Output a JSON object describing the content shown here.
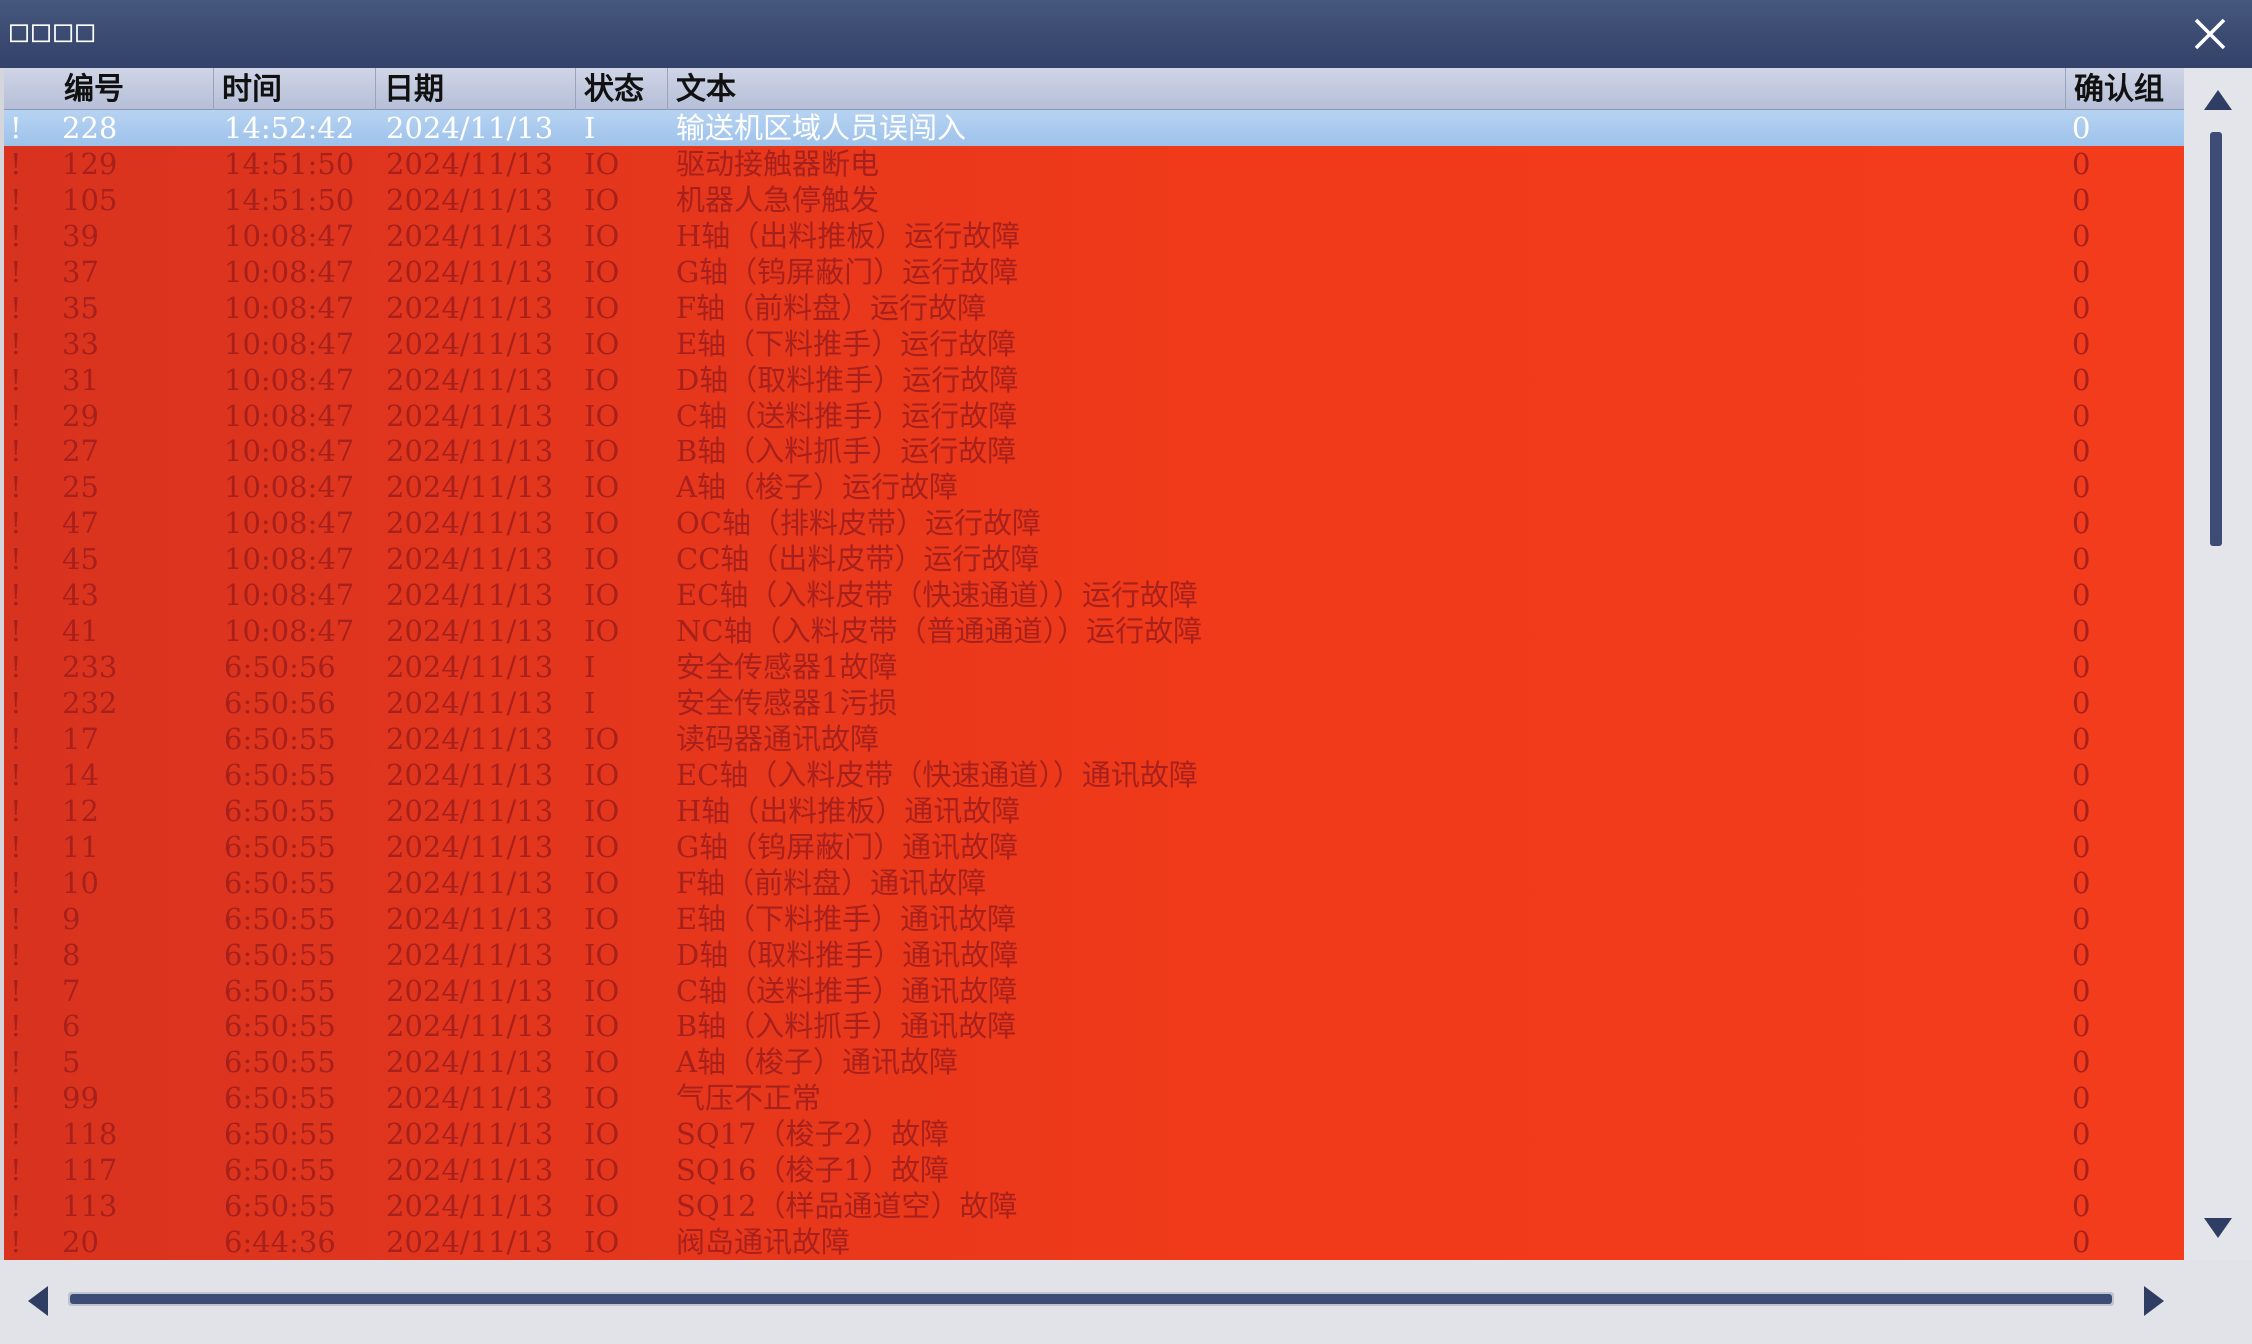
{
  "window": {
    "title": "□□□□",
    "close_icon": "close-icon"
  },
  "columns": {
    "num": "编号",
    "time": "时间",
    "date": "日期",
    "state": "状态",
    "text": "文本",
    "group": "确认组"
  },
  "colors": {
    "row_alarm_bg": "#f03a1a",
    "row_alarm_text": "#a8201c",
    "row_selected_bg": "#a8c8ee",
    "titlebar": "#3a4a70"
  },
  "rows": [
    {
      "mark": "!",
      "num": "228",
      "time": "14:52:42",
      "date": "2024/11/13",
      "state": "I",
      "text": "输送机区域人员误闯入",
      "group": "0",
      "selected": true
    },
    {
      "mark": "!",
      "num": "129",
      "time": "14:51:50",
      "date": "2024/11/13",
      "state": "IO",
      "text": "驱动接触器断电",
      "group": "0"
    },
    {
      "mark": "!",
      "num": "105",
      "time": "14:51:50",
      "date": "2024/11/13",
      "state": "IO",
      "text": "机器人急停触发",
      "group": "0"
    },
    {
      "mark": "!",
      "num": "39",
      "time": "10:08:47",
      "date": "2024/11/13",
      "state": "IO",
      "text": "H轴（出料推板）运行故障",
      "group": "0"
    },
    {
      "mark": "!",
      "num": "37",
      "time": "10:08:47",
      "date": "2024/11/13",
      "state": "IO",
      "text": "G轴（钨屏蔽门）运行故障",
      "group": "0"
    },
    {
      "mark": "!",
      "num": "35",
      "time": "10:08:47",
      "date": "2024/11/13",
      "state": "IO",
      "text": "F轴（前料盘）运行故障",
      "group": "0"
    },
    {
      "mark": "!",
      "num": "33",
      "time": "10:08:47",
      "date": "2024/11/13",
      "state": "IO",
      "text": "E轴（下料推手）运行故障",
      "group": "0"
    },
    {
      "mark": "!",
      "num": "31",
      "time": "10:08:47",
      "date": "2024/11/13",
      "state": "IO",
      "text": "D轴（取料推手）运行故障",
      "group": "0"
    },
    {
      "mark": "!",
      "num": "29",
      "time": "10:08:47",
      "date": "2024/11/13",
      "state": "IO",
      "text": "C轴（送料推手）运行故障",
      "group": "0"
    },
    {
      "mark": "!",
      "num": "27",
      "time": "10:08:47",
      "date": "2024/11/13",
      "state": "IO",
      "text": "B轴（入料抓手）运行故障",
      "group": "0"
    },
    {
      "mark": "!",
      "num": "25",
      "time": "10:08:47",
      "date": "2024/11/13",
      "state": "IO",
      "text": "A轴（梭子）运行故障",
      "group": "0"
    },
    {
      "mark": "!",
      "num": "47",
      "time": "10:08:47",
      "date": "2024/11/13",
      "state": "IO",
      "text": "OC轴（排料皮带）运行故障",
      "group": "0"
    },
    {
      "mark": "!",
      "num": "45",
      "time": "10:08:47",
      "date": "2024/11/13",
      "state": "IO",
      "text": "CC轴（出料皮带）运行故障",
      "group": "0"
    },
    {
      "mark": "!",
      "num": "43",
      "time": "10:08:47",
      "date": "2024/11/13",
      "state": "IO",
      "text": "EC轴（入料皮带（快速通道））运行故障",
      "group": "0"
    },
    {
      "mark": "!",
      "num": "41",
      "time": "10:08:47",
      "date": "2024/11/13",
      "state": "IO",
      "text": "NC轴（入料皮带（普通通道））运行故障",
      "group": "0"
    },
    {
      "mark": "!",
      "num": "233",
      "time": "6:50:56",
      "date": "2024/11/13",
      "state": "I",
      "text": "安全传感器1故障",
      "group": "0"
    },
    {
      "mark": "!",
      "num": "232",
      "time": "6:50:56",
      "date": "2024/11/13",
      "state": "I",
      "text": "安全传感器1污损",
      "group": "0"
    },
    {
      "mark": "!",
      "num": "17",
      "time": "6:50:55",
      "date": "2024/11/13",
      "state": "IO",
      "text": "读码器通讯故障",
      "group": "0"
    },
    {
      "mark": "!",
      "num": "14",
      "time": "6:50:55",
      "date": "2024/11/13",
      "state": "IO",
      "text": "EC轴（入料皮带（快速通道））通讯故障",
      "group": "0"
    },
    {
      "mark": "!",
      "num": "12",
      "time": "6:50:55",
      "date": "2024/11/13",
      "state": "IO",
      "text": "H轴（出料推板）通讯故障",
      "group": "0"
    },
    {
      "mark": "!",
      "num": "11",
      "time": "6:50:55",
      "date": "2024/11/13",
      "state": "IO",
      "text": "G轴（钨屏蔽门）通讯故障",
      "group": "0"
    },
    {
      "mark": "!",
      "num": "10",
      "time": "6:50:55",
      "date": "2024/11/13",
      "state": "IO",
      "text": "F轴（前料盘）通讯故障",
      "group": "0"
    },
    {
      "mark": "!",
      "num": "9",
      "time": "6:50:55",
      "date": "2024/11/13",
      "state": "IO",
      "text": "E轴（下料推手）通讯故障",
      "group": "0"
    },
    {
      "mark": "!",
      "num": "8",
      "time": "6:50:55",
      "date": "2024/11/13",
      "state": "IO",
      "text": "D轴（取料推手）通讯故障",
      "group": "0"
    },
    {
      "mark": "!",
      "num": "7",
      "time": "6:50:55",
      "date": "2024/11/13",
      "state": "IO",
      "text": "C轴（送料推手）通讯故障",
      "group": "0"
    },
    {
      "mark": "!",
      "num": "6",
      "time": "6:50:55",
      "date": "2024/11/13",
      "state": "IO",
      "text": "B轴（入料抓手）通讯故障",
      "group": "0"
    },
    {
      "mark": "!",
      "num": "5",
      "time": "6:50:55",
      "date": "2024/11/13",
      "state": "IO",
      "text": "A轴（梭子）通讯故障",
      "group": "0"
    },
    {
      "mark": "!",
      "num": "99",
      "time": "6:50:55",
      "date": "2024/11/13",
      "state": "IO",
      "text": "气压不正常",
      "group": "0"
    },
    {
      "mark": "!",
      "num": "118",
      "time": "6:50:55",
      "date": "2024/11/13",
      "state": "IO",
      "text": "SQ17（梭子2）故障",
      "group": "0"
    },
    {
      "mark": "!",
      "num": "117",
      "time": "6:50:55",
      "date": "2024/11/13",
      "state": "IO",
      "text": "SQ16（梭子1）故障",
      "group": "0"
    },
    {
      "mark": "!",
      "num": "113",
      "time": "6:50:55",
      "date": "2024/11/13",
      "state": "IO",
      "text": "SQ12（样品通道空）故障",
      "group": "0"
    },
    {
      "mark": "!",
      "num": "20",
      "time": "6:44:36",
      "date": "2024/11/13",
      "state": "IO",
      "text": "阀岛通讯故障",
      "group": "0"
    }
  ],
  "scrollbars": {
    "up_icon": "arrow-up-icon",
    "down_icon": "arrow-down-icon",
    "left_icon": "arrow-left-icon",
    "right_icon": "arrow-right-icon"
  }
}
